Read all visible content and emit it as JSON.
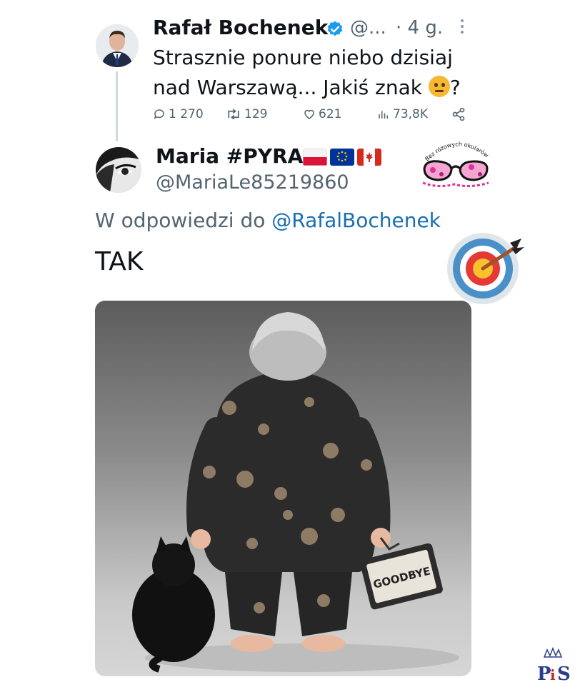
{
  "original_tweet": {
    "author_name": "Rafał Bochenek",
    "handle": "@...",
    "time": "· 4 g.",
    "text_before_emoji": "Strasznie ponure niebo dzisiaj nad Warszawą... Jakiś znak ",
    "text_after_emoji": "?",
    "emoji": "thinking-face",
    "metrics": {
      "replies": "1 270",
      "reposts": "129",
      "likes": "621",
      "views": "73,8K"
    }
  },
  "reply": {
    "author_name": "Maria #PYRA",
    "flags": [
      "poland-flag",
      "eu-flag",
      "canada-flag"
    ],
    "handle": "@MariaLe85219860",
    "replying_prefix": "W odpowiedzi do ",
    "replying_to": "@RafalBochenek",
    "text": "TAK",
    "logo_text": "Bez różowych okularów",
    "image_sign_text": "GOODBYE"
  },
  "watermark_text": "PiS",
  "colors": {
    "verified": "#1d9bf0",
    "link": "#1a6fb0",
    "secondary_text": "#536471"
  }
}
